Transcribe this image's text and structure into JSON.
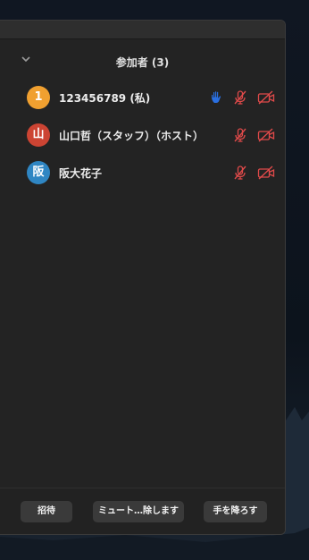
{
  "header": {
    "title": "参加者 (3)"
  },
  "participants": [
    {
      "avatar": "1",
      "avatar_color": "#f0a030",
      "name": "123456789 (私)",
      "hand_raised": true
    },
    {
      "avatar": "山",
      "avatar_color": "#cc4433",
      "name": "山口哲（スタッフ）（ホスト）",
      "hand_raised": false
    },
    {
      "avatar": "阪",
      "avatar_color": "#2f86c3",
      "name": "阪大花子",
      "hand_raised": false
    }
  ],
  "footer": {
    "invite_label": "招待",
    "mute_all_label": "ミュート…除します",
    "lower_hand_label": "手を降ろす"
  },
  "colors": {
    "muted_icon": "#e04a4a",
    "hand_icon": "#2a6fe0",
    "panel_bg": "#232323"
  }
}
